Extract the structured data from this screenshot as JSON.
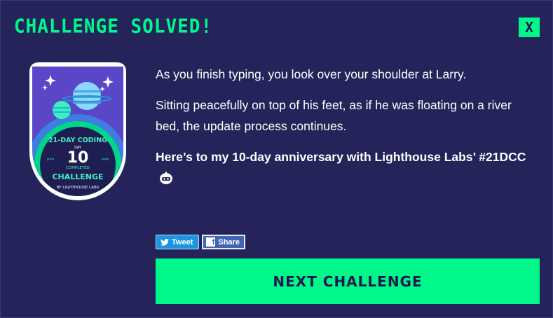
{
  "header": {
    "title": "CHALLENGE SOLVED!",
    "close_label": "X"
  },
  "badge": {
    "line_top": "21-DAY CODING",
    "day_label": "DAY",
    "day_number": "10",
    "completed_label": "COMPLETED",
    "line_bottom": "CHALLENGE",
    "org": "BY LIGHTHOUSE LABS",
    "chevrons_left": ">>>",
    "chevrons_right": "<<<"
  },
  "story": {
    "paragraph_1": "As you finish typing, you look over your shoulder at Larry.",
    "paragraph_2": "Sitting peacefully on top of his feet, as if he was floating on a river bed, the update process continues.",
    "share_text": "Here’s to my 10-day anniversary with Lighthouse Labs’ #21DCC"
  },
  "share": {
    "tweet_label": "Tweet",
    "facebook_label": "Share"
  },
  "actions": {
    "next_label": "NEXT CHALLENGE"
  },
  "colors": {
    "background": "#25245a",
    "accent": "#00f78a",
    "dark_text": "#1c1b4d",
    "twitter": "#1b95e0",
    "facebook": "#4267b2"
  }
}
